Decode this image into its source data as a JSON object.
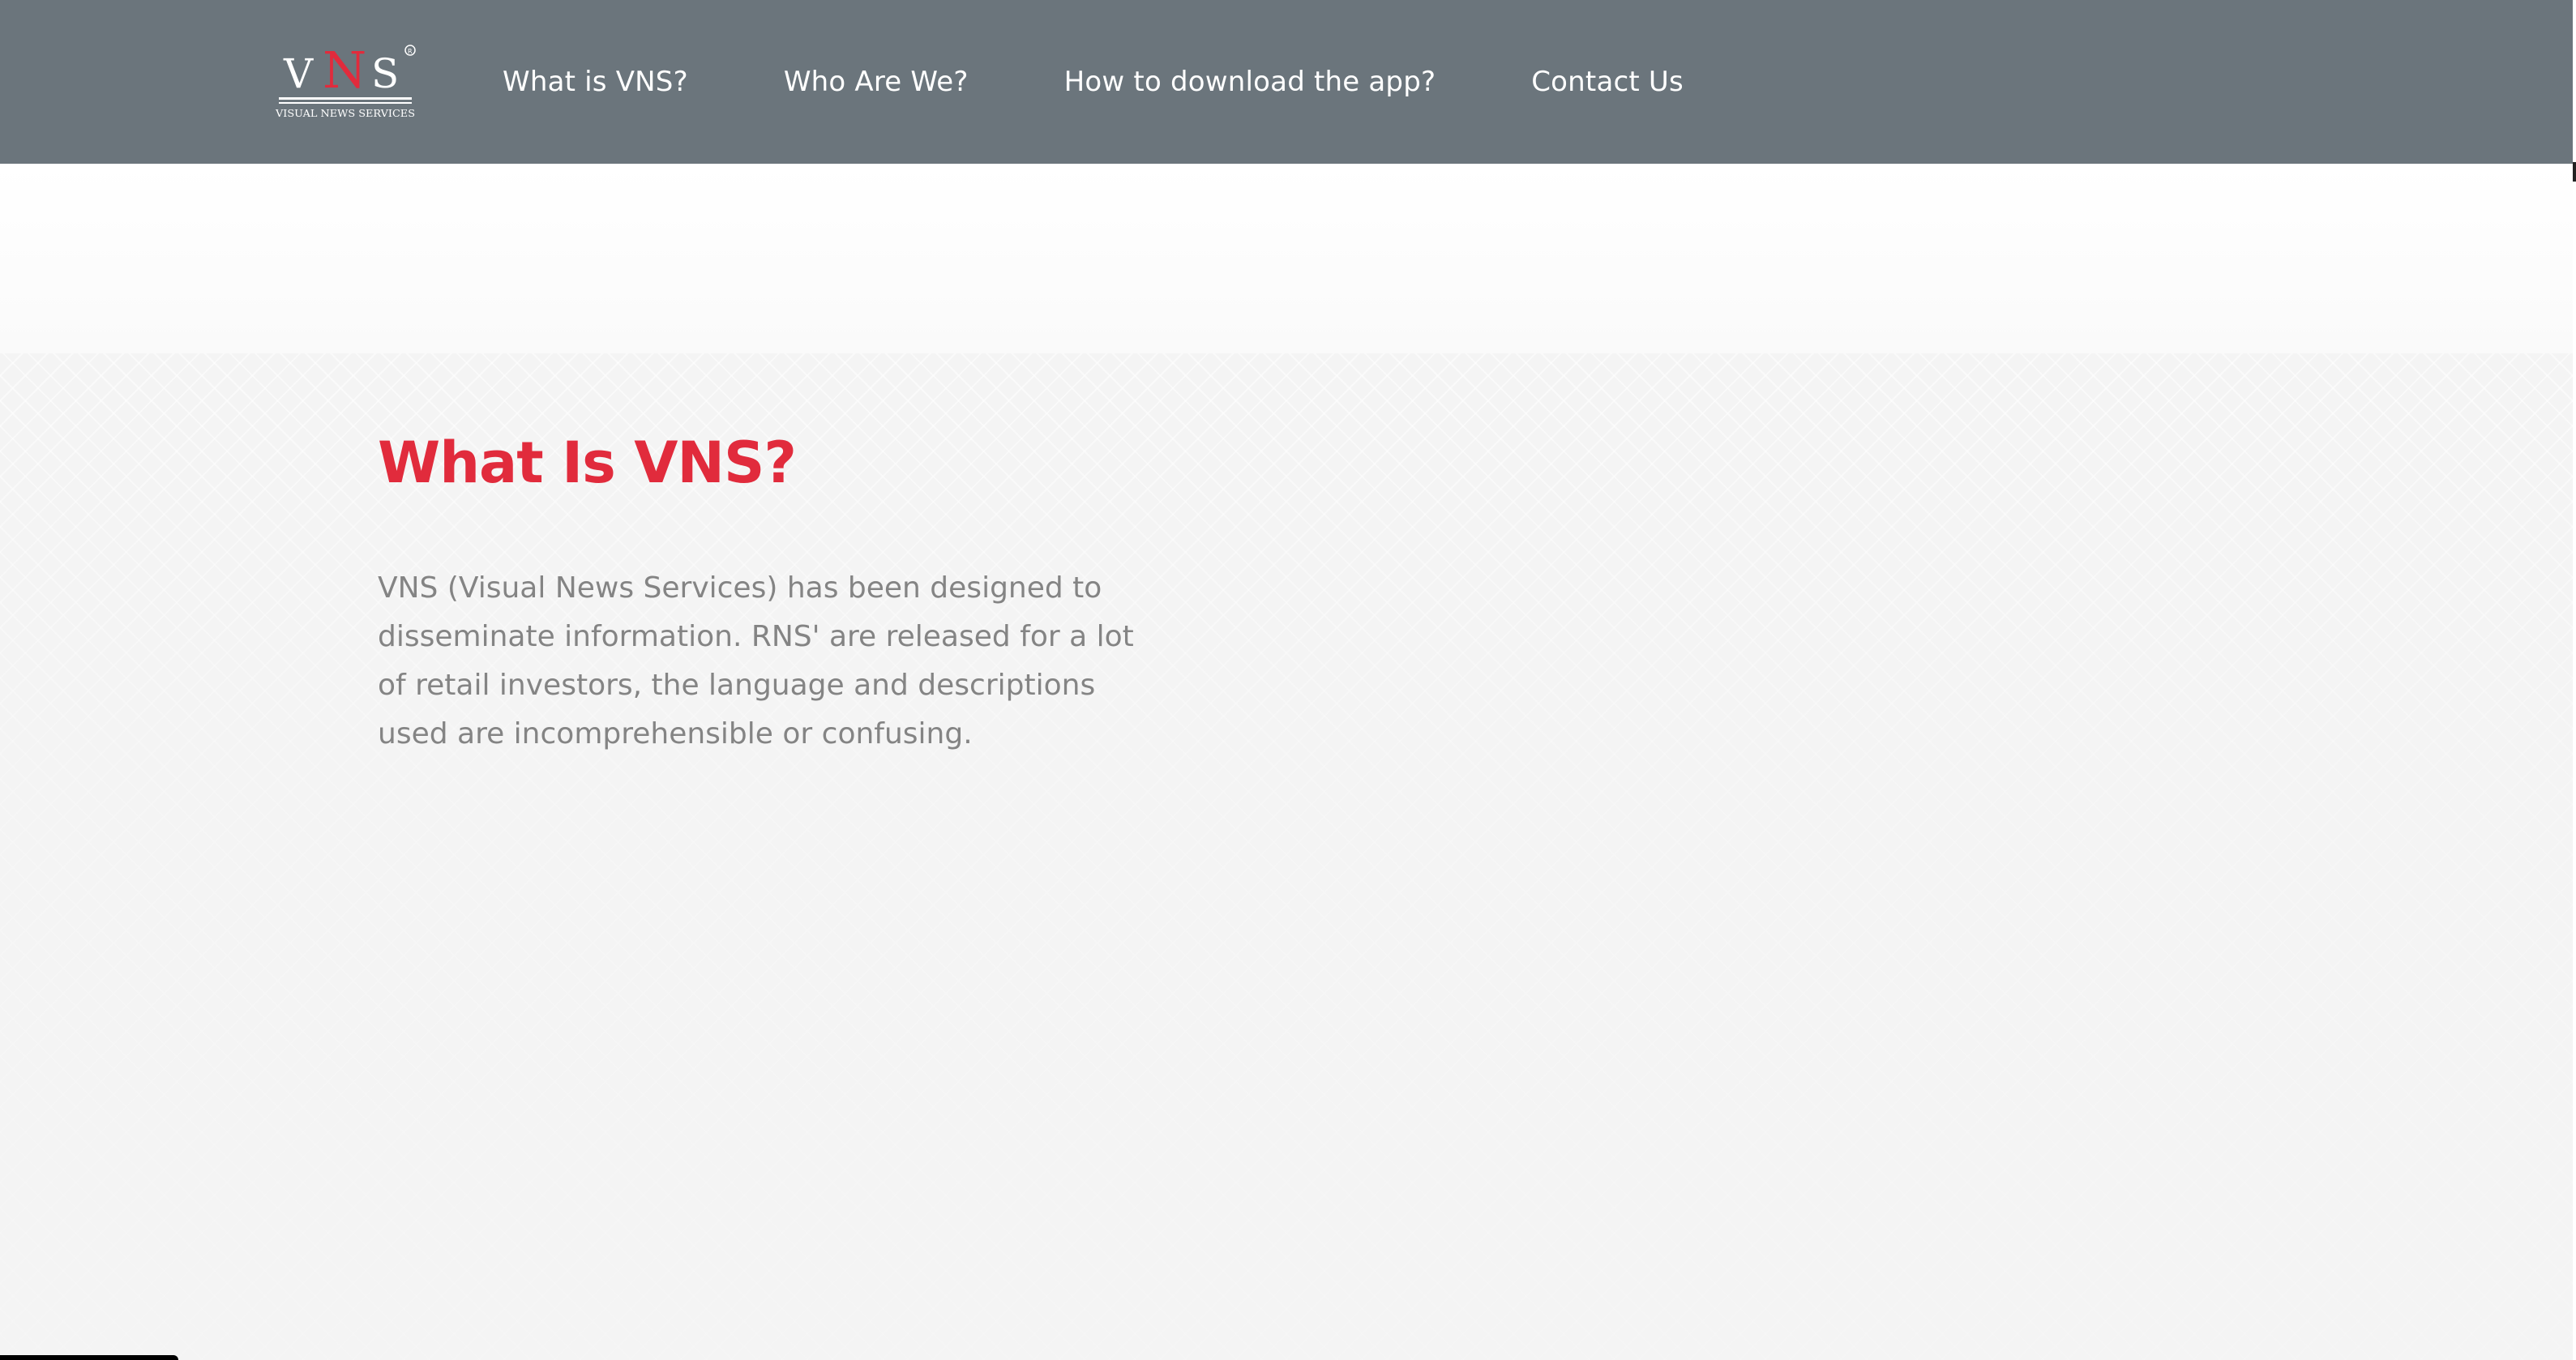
{
  "logo": {
    "letters": "VNS",
    "tagline": "VISUAL NEWS SERVICES",
    "registered_mark": "®",
    "colors": {
      "white": "#ffffff",
      "accent": "#e12b3c"
    }
  },
  "nav": {
    "items": [
      {
        "label": "What is VNS?"
      },
      {
        "label": "Who Are We?"
      },
      {
        "label": "How to download the app?"
      },
      {
        "label": "Contact Us"
      }
    ]
  },
  "main": {
    "title": "What Is VNS?",
    "description": "VNS (Visual News Services) has been designed to disseminate information. RNS' are released for a lot of retail investors, the language and descriptions used are incomprehensible or confusing."
  },
  "colors": {
    "navbar": "#6b757c",
    "title": "#e12b3c",
    "body_text": "#848484",
    "background": "#f4f4f4"
  }
}
